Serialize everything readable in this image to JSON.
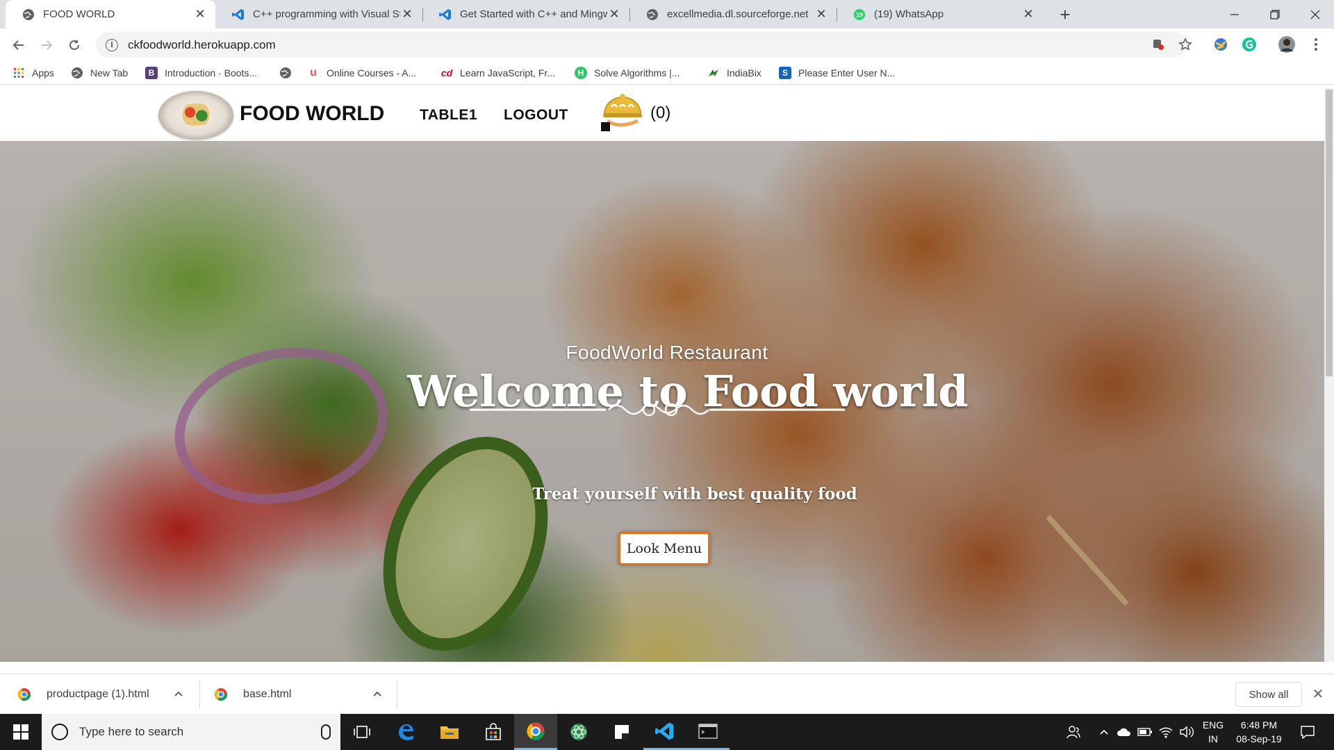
{
  "browser": {
    "tabs": [
      {
        "title": "FOOD WORLD",
        "icon": "globe-icon",
        "active": true
      },
      {
        "title": "C++ programming with Visual St",
        "icon": "vscode-icon",
        "active": false
      },
      {
        "title": "Get Started with C++ and Mingw",
        "icon": "vscode-icon",
        "active": false
      },
      {
        "title": "excellmedia.dl.sourceforge.net",
        "icon": "globe-icon",
        "active": false
      },
      {
        "title": "(19) WhatsApp",
        "icon": "whatsapp-icon",
        "active": false
      }
    ],
    "url": "ckfoodworld.herokuapp.com",
    "bookmarks": [
      {
        "label": "Apps",
        "icon": "apps-grid-icon"
      },
      {
        "label": "New Tab",
        "icon": "globe-icon"
      },
      {
        "label": "Introduction · Boots...",
        "icon": "bootstrap-icon"
      },
      {
        "label": "",
        "icon": "globe-icon"
      },
      {
        "label": "Online Courses - A...",
        "icon": "udemy-icon"
      },
      {
        "label": "Learn JavaScript, Fr...",
        "icon": "codecademy-icon"
      },
      {
        "label": "Solve Algorithms |...",
        "icon": "hackerrank-icon"
      },
      {
        "label": "IndiaBix",
        "icon": "indiabix-icon"
      },
      {
        "label": "Please Enter User N...",
        "icon": "s-icon"
      }
    ]
  },
  "site": {
    "brand": "FOOD WORLD",
    "nav": {
      "table": "TABLE1",
      "logout": "LOGOUT"
    },
    "cart_count": "(0)",
    "hero": {
      "subtitle": "FoodWorld Restaurant",
      "title": "Welcome to Food world",
      "tagline": "Treat yourself with best quality food",
      "button": "Look Menu"
    }
  },
  "downloads": {
    "items": [
      "productpage (1).html",
      "base.html"
    ],
    "show_all": "Show all"
  },
  "taskbar": {
    "search_placeholder": "Type here to search",
    "lang_top": "ENG",
    "lang_bottom": "IN",
    "time": "6:48 PM",
    "date": "08-Sep-19"
  },
  "colors": {
    "accent_orange": "#e0731f",
    "chrome_tabstrip": "#dee1e6",
    "taskbar": "#1b1b1b"
  }
}
